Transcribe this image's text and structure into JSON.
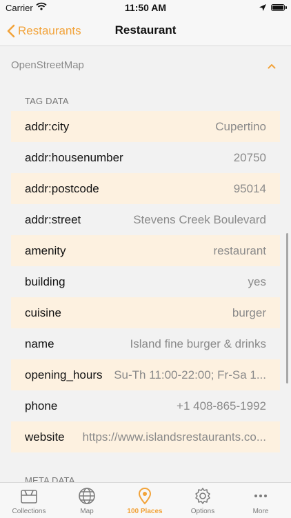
{
  "status_bar": {
    "carrier": "Carrier",
    "time": "11:50 AM"
  },
  "nav": {
    "back_label": "Restaurants",
    "title": "Restaurant"
  },
  "section": {
    "title": "OpenStreetMap"
  },
  "tag_data": {
    "label": "TAG DATA",
    "rows": [
      {
        "key": "addr:city",
        "value": "Cupertino"
      },
      {
        "key": "addr:housenumber",
        "value": "20750"
      },
      {
        "key": "addr:postcode",
        "value": "95014"
      },
      {
        "key": "addr:street",
        "value": "Stevens Creek Boulevard"
      },
      {
        "key": "amenity",
        "value": "restaurant"
      },
      {
        "key": "building",
        "value": "yes"
      },
      {
        "key": "cuisine",
        "value": "burger"
      },
      {
        "key": "name",
        "value": "Island fine burger & drinks"
      },
      {
        "key": "opening_hours",
        "value": "Su-Th 11:00-22:00; Fr-Sa 1..."
      },
      {
        "key": "phone",
        "value": "+1 408-865-1992"
      },
      {
        "key": "website",
        "value": "https://www.islandsrestaurants.co..."
      }
    ]
  },
  "meta_data": {
    "label": "META DATA"
  },
  "tab_bar": {
    "tabs": [
      {
        "label": "Collections",
        "icon": "collections-icon"
      },
      {
        "label": "Map",
        "icon": "globe-icon"
      },
      {
        "label": "100 Places",
        "icon": "location-pin-icon"
      },
      {
        "label": "Options",
        "icon": "gear-icon"
      },
      {
        "label": "More",
        "icon": "more-dots-icon"
      }
    ]
  },
  "colors": {
    "accent": "#f2a33a",
    "row_highlight": "#fdf1e0"
  }
}
